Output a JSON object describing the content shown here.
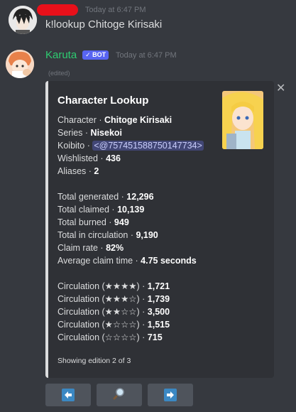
{
  "message1": {
    "timestamp": "Today at 6:47 PM",
    "content": "k!lookup Chitoge Kirisaki"
  },
  "message2": {
    "author": "Karuta",
    "bot_tag": "✓ BOT",
    "timestamp": "Today at 6:47 PM",
    "edited": "(edited)"
  },
  "embed": {
    "title": "Character Lookup",
    "rows": [
      {
        "label": "Character · ",
        "value": "Chitoge Kirisaki"
      },
      {
        "label": "Series · ",
        "value": "Nisekoi"
      },
      {
        "label": "Koibito · ",
        "mention": "<@757451588750147734>"
      },
      {
        "label": "Wishlisted · ",
        "value": "436"
      },
      {
        "label": "Aliases · ",
        "value": "2"
      }
    ],
    "stats": [
      {
        "label": "Total generated · ",
        "value": "12,296"
      },
      {
        "label": "Total claimed · ",
        "value": "10,139"
      },
      {
        "label": "Total burned · ",
        "value": "949"
      },
      {
        "label": "Total in circulation · ",
        "value": "9,190"
      },
      {
        "label": "Claim rate · ",
        "value": "82%"
      },
      {
        "label": "Average claim time · ",
        "value": "4.75 seconds"
      }
    ],
    "circulation": [
      {
        "label": "Circulation (★★★★) · ",
        "value": "1,721"
      },
      {
        "label": "Circulation (★★★☆) · ",
        "value": "1,739"
      },
      {
        "label": "Circulation (★★☆☆) · ",
        "value": "3,500"
      },
      {
        "label": "Circulation (★☆☆☆) · ",
        "value": "1,515"
      },
      {
        "label": "Circulation (☆☆☆☆) · ",
        "value": "715"
      }
    ],
    "footer": "Showing edition 2 of 3"
  },
  "close_glyph": "✕",
  "buttons": [
    {
      "name": "previous-button",
      "icon": "arrow-left-icon"
    },
    {
      "name": "search-button",
      "icon": "magnifier-icon"
    },
    {
      "name": "next-button",
      "icon": "arrow-right-icon"
    }
  ],
  "colors": {
    "background": "#36393f",
    "embed_bg": "#2f3136",
    "author": "#2ecc71",
    "bot_tag": "#5865f2",
    "button": "#4f545c",
    "redaction": "#e8101a"
  }
}
